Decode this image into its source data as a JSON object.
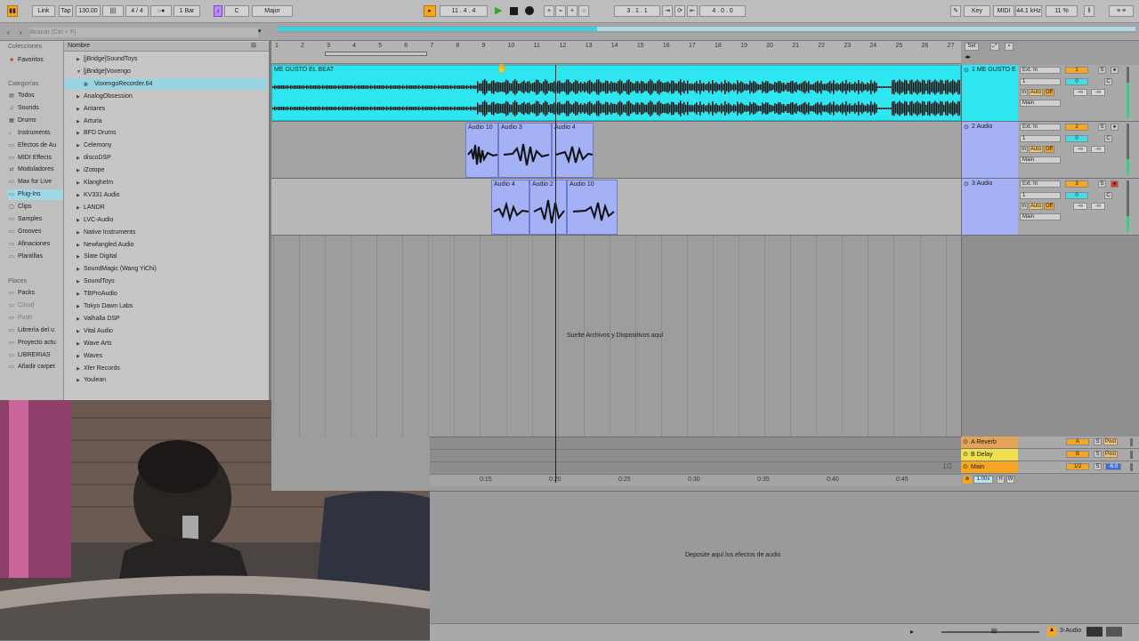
{
  "toolbar": {
    "link": "Link",
    "tap": "Tap",
    "tempo": "130.00",
    "signature": "4 / 4",
    "quantize": "1 Bar",
    "key": "C",
    "scale": "Major",
    "position": "11 .  4 .  4",
    "loop_start": "3 .  1 .  1",
    "loop_length": "4 .  0 .  0",
    "key_label": "Key",
    "midi_label": "MIDI",
    "sample_rate": "44.1 kHz",
    "cpu": "11 %"
  },
  "browser": {
    "search_placeholder": "Buscar (Ctrl + F)",
    "collections_header": "Colecciones",
    "favorites": "Favoritos",
    "categories_header": "Categorías",
    "categories": [
      "Todos",
      "Sounds",
      "Drums",
      "Instruments",
      "Efectos de Au",
      "MIDI Effects",
      "Moduladores",
      "Max for Live",
      "Plug-Ins",
      "Clips",
      "Samples",
      "Grooves",
      "Afinaciones",
      "Plantillas"
    ],
    "places_header": "Places",
    "places": [
      "Packs",
      "Cloud",
      "Push",
      "Librería del u",
      "Proyecto actu",
      "LIBRERIAS",
      "Añadir carpet"
    ],
    "name_header": "Nombre",
    "items": [
      "[jBridge]SoundToys",
      "[jBridge]Voxengo",
      "VoxengoRecorder.64",
      "AnalogObsession",
      "Antares",
      "Arturia",
      "BFD Drums",
      "Celemony",
      "discoDSP",
      "iZotope",
      "Klanghelm",
      "KV331 Audio",
      "LANDR",
      "LVC-Audio",
      "Native Instruments",
      "Newfangled Audio",
      "Slate Digital",
      "SoundMagic (Wang YiChi)",
      "SoundToys",
      "TBProAudio",
      "Tokyo Dawn Labs",
      "Valhalla DSP",
      "Vital Audio",
      "Wave Arts",
      "Waves",
      "Xfer Records",
      "Youlean"
    ]
  },
  "arrangement": {
    "bars": [
      "1",
      "2",
      "3",
      "4",
      "5",
      "6",
      "7",
      "8",
      "9",
      "10",
      "11",
      "12",
      "13",
      "14",
      "15",
      "16",
      "17",
      "18",
      "19",
      "20",
      "21",
      "22",
      "23",
      "24",
      "25",
      "26",
      "27"
    ],
    "set_label": "Set",
    "drop_hint": "Suelte Archivos y Dispositivos aquí",
    "time_labels": [
      "0:15",
      "0:20",
      "0:25",
      "0:30",
      "0:35",
      "0:40",
      "0:45"
    ],
    "zoom": "1/2",
    "tracks": [
      {
        "name": "1 ME GUSTO E",
        "input": "Ext. In",
        "channel": "1",
        "number": "1",
        "send": "0",
        "route": "Main",
        "auto": "Auto",
        "off": "Off",
        "in": "In",
        "vol": "-∞",
        "mute": "S",
        "color": "#2ee6f0"
      },
      {
        "name": "2 Audio",
        "input": "Ext. In",
        "channel": "1",
        "number": "2",
        "send": "0",
        "route": "Main",
        "auto": "Auto",
        "off": "Off",
        "in": "In",
        "vol": "-∞",
        "mute": "S",
        "color": "#a4b1f4"
      },
      {
        "name": "3 Audio",
        "input": "Ext. In",
        "channel": "1",
        "number": "3",
        "send": "0",
        "route": "Main",
        "auto": "Auto",
        "off": "Off",
        "in": "In",
        "vol": "-∞",
        "mute": "S",
        "color": "#a4b1f4"
      }
    ],
    "clips": {
      "main": "ME GUSTO EL BEAT",
      "track2": [
        "Audio 10",
        "Audio 3",
        "Audio 4"
      ],
      "track3": [
        "Audio 4",
        "Audio 2",
        "Audio 10"
      ]
    },
    "returns": [
      {
        "name": "A Reverb",
        "letter": "A",
        "post": "Post",
        "color": "#e5a35a"
      },
      {
        "name": "B Delay",
        "letter": "B",
        "post": "Post",
        "color": "#f1e04d"
      },
      {
        "name": "Main",
        "letter": "1/2",
        "post": "0",
        "color": "#f5a623",
        "vol": "-6.0"
      }
    ],
    "main_zoom": "1.00x"
  },
  "detail": {
    "drop_hint": "Deposite aquí los efectos de audio",
    "track_label": "3-Audio"
  }
}
